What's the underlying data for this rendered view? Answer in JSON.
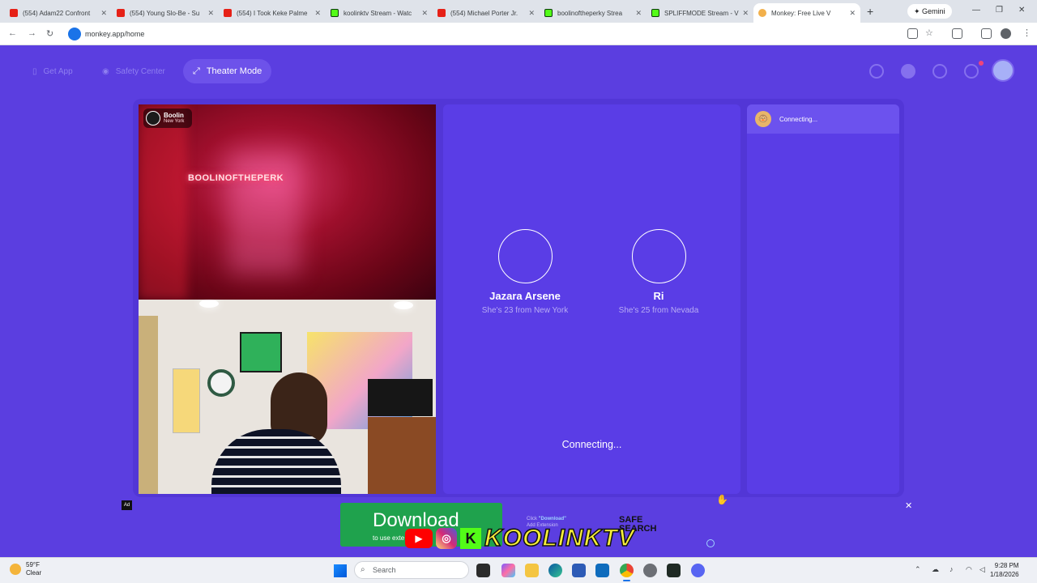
{
  "browser": {
    "tabs": [
      {
        "title": "(554) Adam22 Confront",
        "favicon": "youtube-icon",
        "active": false
      },
      {
        "title": "(554) Young Slo-Be - Su",
        "favicon": "youtube-icon",
        "active": false
      },
      {
        "title": "(554) I Took Keke Palme",
        "favicon": "youtube-icon",
        "active": false
      },
      {
        "title": "koolinktv Stream - Watc",
        "favicon": "kick-icon",
        "active": false
      },
      {
        "title": "(554) Michael Porter Jr.",
        "favicon": "youtube-icon",
        "active": false
      },
      {
        "title": "boolinoftheperky Strea",
        "favicon": "kick-icon",
        "active": false
      },
      {
        "title": "SPLIFFMODE Stream - V",
        "favicon": "kick-icon",
        "active": false
      },
      {
        "title": "Monkey: Free Live V",
        "favicon": "monkey-icon",
        "active": true
      }
    ],
    "new_tab": "+",
    "gemini_label": "Gemini",
    "url": "monkey.app/home"
  },
  "header": {
    "get_app": "Get App",
    "safety_center": "Safety Center",
    "theater_mode": "Theater Mode"
  },
  "video": {
    "peer_name": "Boolin",
    "peer_location": "New York",
    "neon_sign": "BOOLINOFTHEPERK"
  },
  "match": {
    "profiles": [
      {
        "name": "Jazara Arsene",
        "desc": "She's 23 from New York"
      },
      {
        "name": "Ri",
        "desc": "She's 25 from Nevada"
      }
    ],
    "status": "Connecting..."
  },
  "chat": {
    "status": "Connecting..."
  },
  "ad": {
    "label": "Ad",
    "download": "Download",
    "sub": "to use exte",
    "click_prefix": "Click",
    "click_link": "\"Download\"",
    "click_line2": "Add Extension",
    "safe_search_1": "SAFE",
    "safe_search_2": "SEARCH",
    "close": "✕"
  },
  "overlay": {
    "ig_label": "◎",
    "k_label": "K",
    "text": "KOOLINKTV"
  },
  "taskbar": {
    "temp": "59°F",
    "condition": "Clear",
    "search_placeholder": "Search",
    "time": "9:28 PM",
    "date": "1/18/2026"
  },
  "colors": {
    "page_bg": "#5b3ee0",
    "panel": "#5a3de6",
    "accent_green": "#1fa24d"
  }
}
